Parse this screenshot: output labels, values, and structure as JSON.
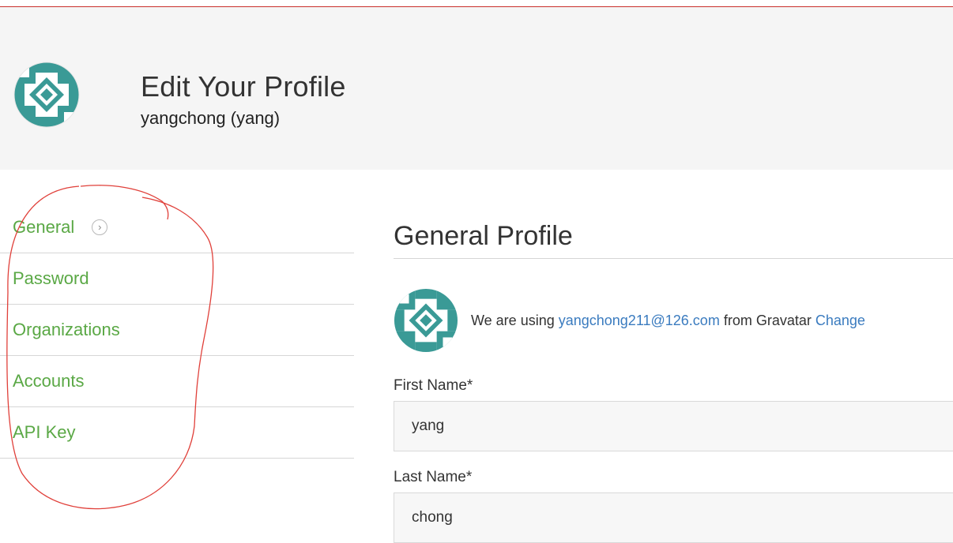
{
  "header": {
    "title": "Edit Your Profile",
    "username": "yangchong (yang)"
  },
  "sidenav": {
    "items": [
      {
        "label": "General",
        "active": true
      },
      {
        "label": "Password"
      },
      {
        "label": "Organizations"
      },
      {
        "label": "Accounts"
      },
      {
        "label": "API Key"
      }
    ],
    "active_icon": "chevron-right-icon"
  },
  "content": {
    "section_title": "General Profile",
    "gravatar": {
      "prefix": "We are using ",
      "email": "yangchong211@126.com",
      "middle": " from Gravatar ",
      "change_label": "Change"
    },
    "fields": [
      {
        "label": "First Name*",
        "value": "yang"
      },
      {
        "label": "Last Name*",
        "value": "chong"
      }
    ]
  },
  "colors": {
    "accent_green": "#5aa845",
    "link_blue": "#3a7bbf",
    "annotation_red": "#e0403a",
    "avatar_teal": "#3a9a96"
  }
}
